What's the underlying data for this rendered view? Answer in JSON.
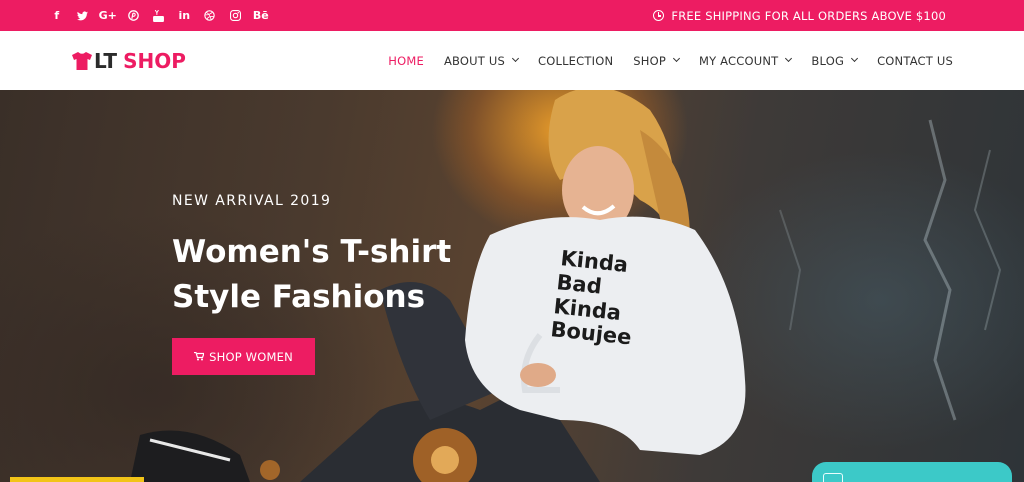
{
  "topbar": {
    "social": [
      {
        "icon": "facebook-icon",
        "glyph": "f"
      },
      {
        "icon": "twitter-icon",
        "glyph": "🐦"
      },
      {
        "icon": "google-plus-icon",
        "glyph": "G+"
      },
      {
        "icon": "pinterest-icon",
        "glyph": "℗"
      },
      {
        "icon": "youtube-icon",
        "glyph": "▶"
      },
      {
        "icon": "linkedin-icon",
        "glyph": "in"
      },
      {
        "icon": "dribbble-icon",
        "glyph": "⊛"
      },
      {
        "icon": "instagram-icon",
        "glyph": "◎"
      },
      {
        "icon": "behance-icon",
        "glyph": "Bē"
      }
    ],
    "shipping_icon": "clock-icon",
    "shipping_text": "FREE SHIPPING FOR ALL ORDERS ABOVE $100"
  },
  "logo": {
    "icon": "tshirt-icon",
    "part1": "LT",
    "part2": "SHOP"
  },
  "nav": {
    "items": [
      {
        "label": "HOME",
        "active": true,
        "dropdown": false
      },
      {
        "label": "ABOUT US",
        "active": false,
        "dropdown": true
      },
      {
        "label": "COLLECTION",
        "active": false,
        "dropdown": false
      },
      {
        "label": "SHOP",
        "active": false,
        "dropdown": true
      },
      {
        "label": "MY ACCOUNT",
        "active": false,
        "dropdown": true
      },
      {
        "label": "BLOG",
        "active": false,
        "dropdown": true
      },
      {
        "label": "CONTACT US",
        "active": false,
        "dropdown": false
      }
    ]
  },
  "hero": {
    "eyebrow": "NEW ARRIVAL 2019",
    "headline": "Women's T-shirt Style Fashions",
    "cta_icon": "cart-icon",
    "cta_label": "SHOP WOMEN",
    "sweater_lines": [
      "Kinda",
      "Bad",
      "Kinda",
      "Boujee"
    ]
  },
  "colors": {
    "accent": "#ed1c62",
    "chat": "#3cc9c8",
    "yellow": "#f2c418"
  }
}
